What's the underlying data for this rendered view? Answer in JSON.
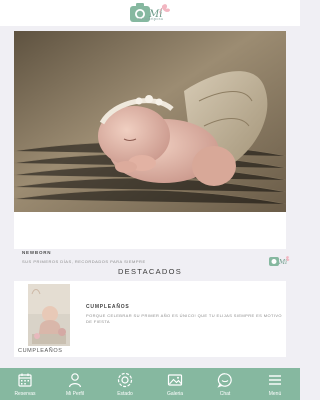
{
  "header": {
    "logo_text": "Mi",
    "logo_tagline": "mi mariposa"
  },
  "feature": {
    "title": "NEWBORN",
    "subtitle": "SUS PRIMEROS DÍAS, RECORDADOS PARA SIEMPRE"
  },
  "highlights": {
    "section_title": "DESTACADOS",
    "item_title": "CUMPLEAÑOS",
    "item_description": "PORQUE CELEBRAR SU PRIMER AÑO ES ÚNICO! QUE TU ELIJAS SIEMPRE ES MOTIVO DE FIESTA",
    "item_caption": "CUMPLEAÑOS"
  },
  "tabs": [
    {
      "label": "Reservas",
      "icon": "calendar-icon"
    },
    {
      "label": "Mi Perfil",
      "icon": "user-icon"
    },
    {
      "label": "Estado",
      "icon": "status-circle-icon"
    },
    {
      "label": "Galeria",
      "icon": "gallery-icon"
    },
    {
      "label": "Chat",
      "icon": "chat-icon"
    },
    {
      "label": "Menú",
      "icon": "menu-icon"
    }
  ],
  "colors": {
    "accent": "#86b8a0",
    "background": "#f0eff4"
  }
}
